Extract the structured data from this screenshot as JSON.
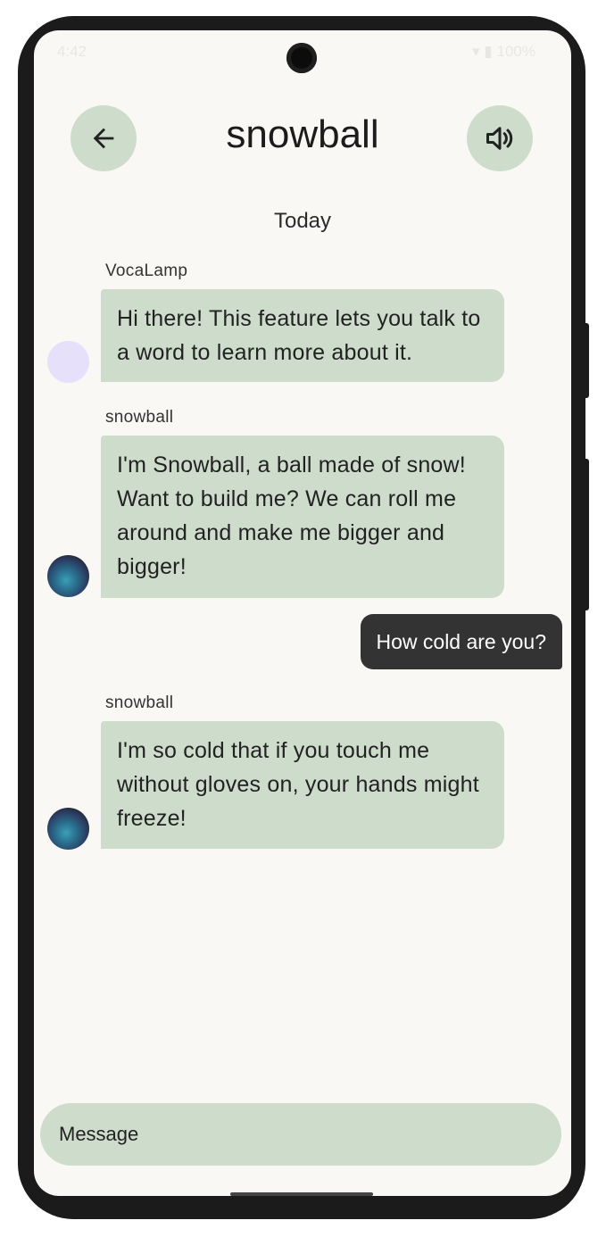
{
  "status": {
    "time": "4:42",
    "battery": "100%"
  },
  "header": {
    "title": "snowball"
  },
  "chat": {
    "date_label": "Today",
    "messages": [
      {
        "sender": "VocaLamp",
        "text": "Hi there! This feature lets you talk to a word to learn more about it."
      },
      {
        "sender": "snowball",
        "text": "I'm Snowball, a ball made of snow! Want to build me? We can roll me around and make me bigger and bigger!"
      },
      {
        "user_text": "How cold are you?"
      },
      {
        "sender": "snowball",
        "text": "I'm so cold that if you touch me without gloves on, your hands might freeze!"
      }
    ]
  },
  "composer": {
    "placeholder": "Message"
  },
  "colors": {
    "accent": "#cddccb",
    "background": "#faf8f5",
    "user_bubble": "#333333"
  }
}
